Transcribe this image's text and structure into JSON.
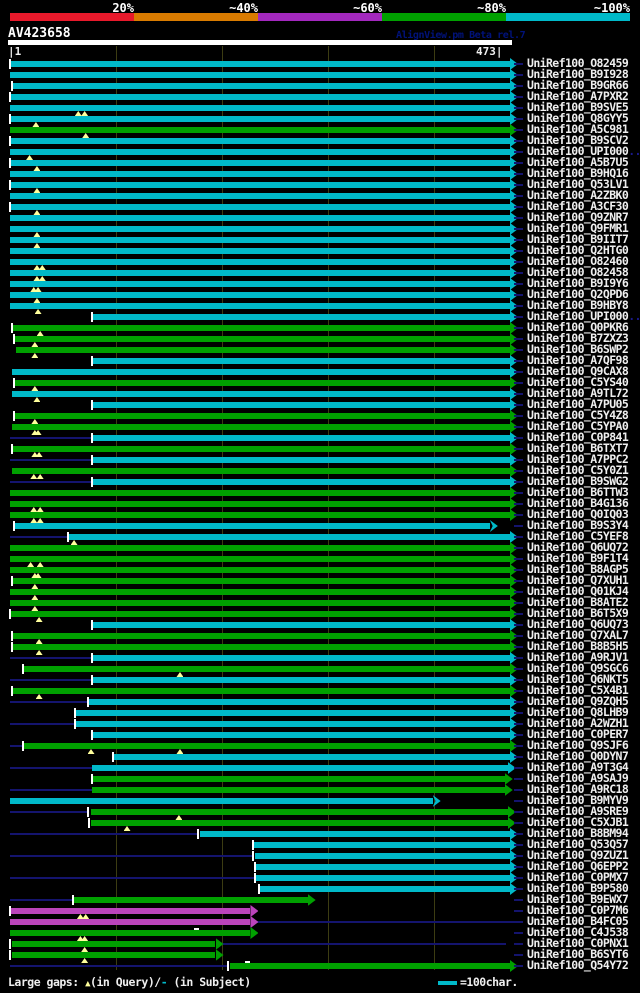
{
  "header": {
    "title": "AV423658",
    "watermark": "AlignView.pm Beta rel.7",
    "scale_labels": [
      "20%",
      "~40%",
      "~60%",
      "~80%",
      "~100%"
    ],
    "scale_colors": [
      "#e8192b",
      "#d97b00",
      "#a328be",
      "#00a000",
      "#00b9c9"
    ]
  },
  "ruler": {
    "start_label": "|1",
    "end_label": "473|"
  },
  "legend": {
    "prefix": "Large gaps: ",
    "tri": "▲",
    "mid": "(in Query)/",
    "dash": "-",
    "suffix": " (in Subject)",
    "scalebar_label": "=100char."
  },
  "palette": {
    "cyan": "#00b9c9",
    "green": "#00a000",
    "magenta": "#bb44bb",
    "navy": "#14146e",
    "grid": "#3c3c12",
    "tick": "#ffffff",
    "gap_triangle": "#ffff9c",
    "gap_dash": "#ffffff"
  },
  "chart_data": {
    "type": "bar",
    "subtype": "alignment-overview",
    "title": "AV423658",
    "query_range": [
      1,
      473
    ],
    "tick_interval": 100,
    "grid": true,
    "identity_buckets": {
      "red": "20%",
      "orange": "~40%",
      "magenta": "~60%",
      "green": "~80%",
      "cyan": "~100%"
    },
    "hits": [
      {
        "id": "UniRef100_O82459",
        "color": "cyan",
        "from": 1,
        "to": 473,
        "tick": 1
      },
      {
        "id": "UniRef100_B9I928",
        "color": "cyan",
        "from": 1,
        "to": 473
      },
      {
        "id": "UniRef100_B9GR66",
        "color": "cyan",
        "from": 3,
        "to": 473,
        "tick": 3
      },
      {
        "id": "UniRef100_A7PXR2",
        "color": "cyan",
        "from": 1,
        "to": 473,
        "tick": 1
      },
      {
        "id": "UniRef100_B9SVE5",
        "color": "cyan",
        "from": 1,
        "to": 473,
        "tris": [
          65,
          71
        ]
      },
      {
        "id": "UniRef100_Q8GYY5",
        "color": "cyan",
        "from": 1,
        "to": 473,
        "tick": 1,
        "tris": [
          25
        ]
      },
      {
        "id": "UniRef100_A5C981",
        "color": "green",
        "from": 1,
        "to": 473,
        "tris": [
          72
        ]
      },
      {
        "id": "UniRef100_B9SCV2",
        "color": "cyan",
        "from": 1,
        "to": 473,
        "tick": 1
      },
      {
        "id": "UniRef100_UPI000",
        "suffix": "..",
        "color": "cyan",
        "from": 1,
        "to": 473,
        "tris": [
          19
        ]
      },
      {
        "id": "UniRef100_A5B7U5",
        "color": "cyan",
        "from": 1,
        "to": 473,
        "tick": 1,
        "tris": [
          26
        ]
      },
      {
        "id": "UniRef100_B9HQ16",
        "color": "cyan",
        "from": 1,
        "to": 473
      },
      {
        "id": "UniRef100_Q53LV1",
        "color": "cyan",
        "from": 1,
        "to": 473,
        "tick": 1,
        "tris": [
          26
        ]
      },
      {
        "id": "UniRef100_A2ZBK0",
        "color": "cyan",
        "from": 1,
        "to": 473
      },
      {
        "id": "UniRef100_A3CF30",
        "color": "cyan",
        "from": 1,
        "to": 473,
        "tick": 1,
        "tris": [
          26
        ]
      },
      {
        "id": "UniRef100_Q9ZNR7",
        "color": "cyan",
        "from": 1,
        "to": 473
      },
      {
        "id": "UniRef100_Q9FMR1",
        "color": "cyan",
        "from": 1,
        "to": 473,
        "tris": [
          26
        ]
      },
      {
        "id": "UniRef100_B9IIT7",
        "color": "cyan",
        "from": 1,
        "to": 473,
        "tris": [
          26
        ]
      },
      {
        "id": "UniRef100_Q2HTG0",
        "color": "cyan",
        "from": 1,
        "to": 473
      },
      {
        "id": "UniRef100_O82460",
        "color": "cyan",
        "from": 1,
        "to": 473,
        "tris": [
          26,
          31
        ]
      },
      {
        "id": "UniRef100_O82458",
        "color": "cyan",
        "from": 1,
        "to": 473,
        "tris": [
          26,
          31
        ]
      },
      {
        "id": "UniRef100_B9I9Y6",
        "color": "cyan",
        "from": 1,
        "to": 473,
        "tris": [
          23,
          27
        ]
      },
      {
        "id": "UniRef100_Q2QPD6",
        "color": "cyan",
        "from": 1,
        "to": 473,
        "tris": [
          26
        ]
      },
      {
        "id": "UniRef100_B9HBY8",
        "color": "cyan",
        "from": 1,
        "to": 473,
        "tris": [
          27
        ]
      },
      {
        "id": "UniRef100_UPI000",
        "suffix": "..",
        "color": "cyan",
        "from": 78,
        "to": 473,
        "tick": 78
      },
      {
        "id": "UniRef100_Q0PKR6",
        "color": "green",
        "from": 3,
        "to": 473,
        "tick": 3,
        "tris": [
          29
        ]
      },
      {
        "id": "UniRef100_B7ZXZ3",
        "color": "green",
        "from": 5,
        "to": 473,
        "tick": 5,
        "tris": [
          24
        ]
      },
      {
        "id": "UniRef100_B6SWP2",
        "color": "green",
        "from": 7,
        "to": 473,
        "tris": [
          24
        ]
      },
      {
        "id": "UniRef100_A7QF98",
        "color": "cyan",
        "from": 78,
        "to": 473,
        "tick": 78
      },
      {
        "id": "UniRef100_Q9CAX8",
        "color": "cyan",
        "from": 3,
        "to": 473
      },
      {
        "id": "UniRef100_C5YS40",
        "color": "green",
        "from": 5,
        "to": 473,
        "tick": 5,
        "tris": [
          24
        ]
      },
      {
        "id": "UniRef100_A9TL72",
        "color": "cyan",
        "from": 3,
        "to": 473,
        "tris": [
          26
        ]
      },
      {
        "id": "UniRef100_A7PU05",
        "color": "cyan",
        "from": 78,
        "to": 473,
        "tick": 78
      },
      {
        "id": "UniRef100_C5Y4Z8",
        "color": "green",
        "from": 5,
        "to": 473,
        "tick": 5,
        "tris": [
          24
        ]
      },
      {
        "id": "UniRef100_C5YPA0",
        "color": "green",
        "from": 3,
        "to": 473,
        "tris": [
          24,
          27
        ]
      },
      {
        "id": "UniRef100_C0P841",
        "color": "cyan",
        "from": 78,
        "to": 473,
        "pre": [
          1,
          78
        ],
        "tick": 78
      },
      {
        "id": "UniRef100_B6TXT7",
        "color": "green",
        "from": 3,
        "to": 473,
        "tick": 3,
        "tris": [
          24,
          28
        ]
      },
      {
        "id": "UniRef100_A7PPC2",
        "color": "cyan",
        "from": 78,
        "to": 473,
        "pre": [
          1,
          78
        ],
        "tick": 78
      },
      {
        "id": "UniRef100_C5Y0Z1",
        "color": "green",
        "from": 3,
        "to": 473,
        "tris": [
          23,
          29
        ]
      },
      {
        "id": "UniRef100_B9SWG2",
        "color": "cyan",
        "from": 78,
        "to": 473,
        "pre": [
          1,
          78
        ],
        "tick": 78
      },
      {
        "id": "UniRef100_B6TTW3",
        "color": "green",
        "from": 1,
        "to": 473
      },
      {
        "id": "UniRef100_B4G136",
        "color": "green",
        "from": 1,
        "to": 473,
        "tris": [
          23,
          29
        ]
      },
      {
        "id": "UniRef100_Q0IQ03",
        "color": "green",
        "from": 1,
        "to": 473,
        "tris": [
          23,
          29
        ]
      },
      {
        "id": "UniRef100_B9S3Y4",
        "color": "cyan",
        "from": 5,
        "to": 454,
        "tick": 5,
        "arrow": "open"
      },
      {
        "id": "UniRef100_C5YEF8",
        "color": "cyan",
        "from": 56,
        "to": 473,
        "pre": [
          1,
          56
        ],
        "tick": 56,
        "tris": [
          61
        ]
      },
      {
        "id": "UniRef100_Q6UQ72",
        "color": "green",
        "from": 1,
        "to": 473
      },
      {
        "id": "UniRef100_B9F1T4",
        "color": "green",
        "from": 1,
        "to": 473,
        "tris": [
          20,
          29
        ]
      },
      {
        "id": "UniRef100_B8AGP5",
        "color": "green",
        "from": 1,
        "to": 473,
        "tris": [
          24,
          27
        ]
      },
      {
        "id": "UniRef100_Q7XUH1",
        "color": "green",
        "from": 3,
        "to": 473,
        "tick": 3,
        "tris": [
          24
        ]
      },
      {
        "id": "UniRef100_Q01KJ4",
        "color": "green",
        "from": 1,
        "to": 473,
        "tris": [
          24
        ]
      },
      {
        "id": "UniRef100_B8ATE2",
        "color": "green",
        "from": 1,
        "to": 473,
        "tris": [
          24
        ]
      },
      {
        "id": "UniRef100_B6T5X9",
        "color": "green",
        "from": 1,
        "to": 473,
        "tick": 1,
        "tris": [
          28
        ]
      },
      {
        "id": "UniRef100_Q6UQ73",
        "color": "cyan",
        "from": 78,
        "to": 473,
        "tick": 78
      },
      {
        "id": "UniRef100_Q7XAL7",
        "color": "green",
        "from": 3,
        "to": 473,
        "tick": 3,
        "tris": [
          28
        ]
      },
      {
        "id": "UniRef100_B8B5H5",
        "color": "green",
        "from": 3,
        "to": 473,
        "tick": 3,
        "tris": [
          28
        ]
      },
      {
        "id": "UniRef100_A9RJV1",
        "color": "cyan",
        "from": 78,
        "to": 473,
        "pre": [
          1,
          78
        ],
        "tick": 78
      },
      {
        "id": "UniRef100_Q9SGC6",
        "color": "green",
        "from": 14,
        "to": 473,
        "tick": 13,
        "tris": [
          161
        ]
      },
      {
        "id": "UniRef100_Q6NKT5",
        "color": "cyan",
        "from": 78,
        "to": 473,
        "pre": [
          1,
          78
        ],
        "tick": 78
      },
      {
        "id": "UniRef100_C5X4B1",
        "color": "green",
        "from": 3,
        "to": 473,
        "tick": 3,
        "tris": [
          28
        ]
      },
      {
        "id": "UniRef100_Q9ZQH5",
        "color": "cyan",
        "from": 75,
        "to": 473,
        "pre": [
          1,
          75
        ],
        "tick": 75
      },
      {
        "id": "UniRef100_Q8LHB9",
        "color": "cyan",
        "from": 62,
        "to": 473,
        "tick": 62
      },
      {
        "id": "UniRef100_A2WZH1",
        "color": "cyan",
        "from": 62,
        "to": 473,
        "pre": [
          1,
          62
        ],
        "tick": 62
      },
      {
        "id": "UniRef100_C0PER7",
        "color": "cyan",
        "from": 78,
        "to": 473,
        "tick": 78
      },
      {
        "id": "UniRef100_Q9SJF6",
        "color": "green",
        "from": 13,
        "to": 473,
        "pre": [
          1,
          12
        ],
        "tick": 13,
        "tris": [
          77,
          161
        ]
      },
      {
        "id": "UniRef100_Q0DYN7",
        "color": "cyan",
        "from": 98,
        "to": 473,
        "tick": 98
      },
      {
        "id": "UniRef100_A9T3G4",
        "color": "cyan",
        "from": 78,
        "to": 471,
        "pre": [
          1,
          78
        ]
      },
      {
        "id": "UniRef100_A9SAJ9",
        "color": "green",
        "from": 78,
        "to": 468,
        "tick": 78
      },
      {
        "id": "UniRef100_A9RC18",
        "color": "green",
        "from": 78,
        "to": 468,
        "pre": [
          1,
          78
        ]
      },
      {
        "id": "UniRef100_B9MYV9",
        "color": "cyan",
        "from": 1,
        "to": 400,
        "arrow": "open"
      },
      {
        "id": "UniRef100_A9SRE9",
        "color": "green",
        "from": 77,
        "to": 471,
        "pre": [
          1,
          75
        ],
        "tick": 75,
        "tris": [
          160
        ]
      },
      {
        "id": "UniRef100_C5XJB1",
        "color": "green",
        "from": 77,
        "to": 471,
        "tick": 76,
        "tris": [
          111
        ]
      },
      {
        "id": "UniRef100_B8BM94",
        "color": "cyan",
        "from": 180,
        "to": 473,
        "pre": [
          1,
          178
        ],
        "tick": 178
      },
      {
        "id": "UniRef100_Q53Q57",
        "color": "cyan",
        "from": 230,
        "to": 473,
        "tick": 230
      },
      {
        "id": "UniRef100_Q9ZUZ1",
        "color": "cyan",
        "from": 232,
        "to": 473,
        "pre": [
          1,
          230
        ],
        "tick": 230
      },
      {
        "id": "UniRef100_Q6EPP2",
        "color": "cyan",
        "from": 232,
        "to": 473,
        "tick": 232
      },
      {
        "id": "UniRef100_C0PMX7",
        "color": "cyan",
        "from": 233,
        "to": 473,
        "pre": [
          1,
          232
        ],
        "tick": 232
      },
      {
        "id": "UniRef100_B9P580",
        "color": "cyan",
        "from": 236,
        "to": 473,
        "tick": 236
      },
      {
        "id": "UniRef100_B9EWX7",
        "color": "green",
        "from": 61,
        "to": 282,
        "pre": [
          1,
          60
        ],
        "tick": 60
      },
      {
        "id": "UniRef100_C0P7M6",
        "color": "magenta",
        "from": 1,
        "to": 228,
        "tick": 1,
        "tris": [
          67,
          72
        ]
      },
      {
        "id": "UniRef100_B4FC05",
        "color": "magenta",
        "from": 1,
        "to": 228,
        "post": [
          230,
          477
        ]
      },
      {
        "id": "UniRef100_C4J538",
        "color": "green",
        "from": 1,
        "to": 228,
        "tris": [
          67,
          71
        ],
        "dashes": [
          177
        ]
      },
      {
        "id": "UniRef100_C0PNX1",
        "color": "green",
        "from": 3,
        "to": 195,
        "tick": 1,
        "tris": [
          71
        ],
        "post": [
          197,
          469
        ]
      },
      {
        "id": "UniRef100_B6SYT6",
        "color": "green",
        "from": 3,
        "to": 195,
        "tick": 1,
        "tris": [
          71
        ]
      },
      {
        "id": "UniRef100_Q54Y72",
        "color": "green",
        "from": 209,
        "to": 473,
        "pre": [
          1,
          207
        ],
        "tick": 207,
        "dashes": [
          225
        ]
      }
    ]
  }
}
